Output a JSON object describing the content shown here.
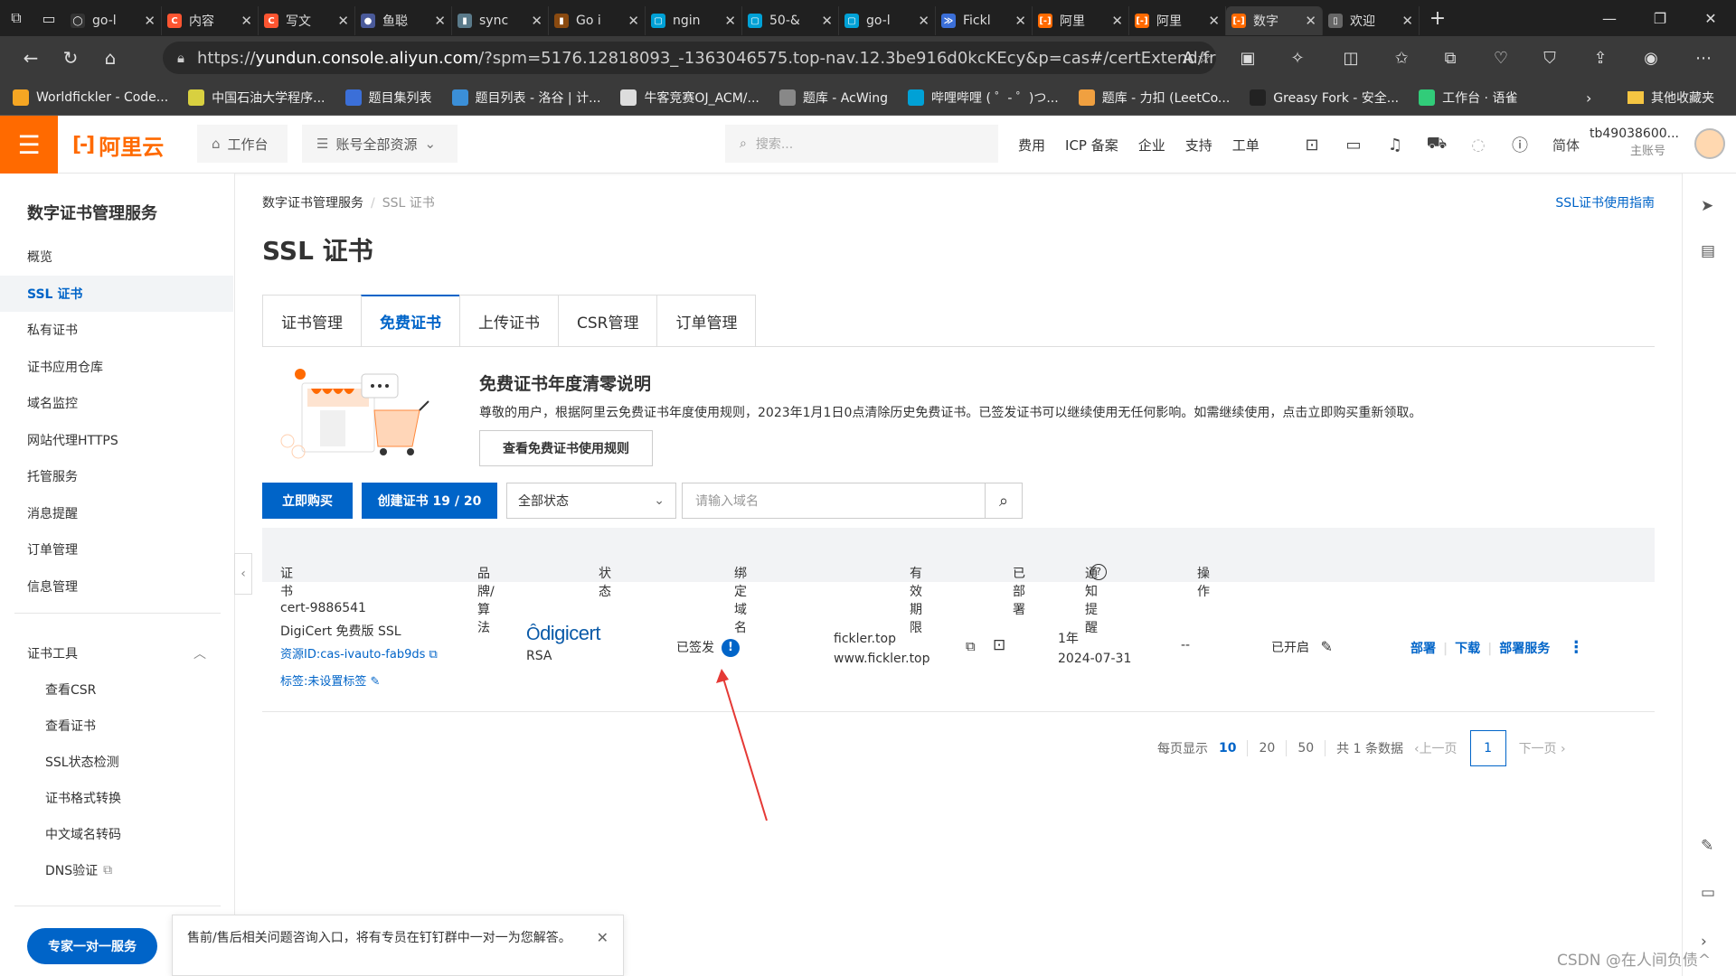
{
  "browser": {
    "tabs": [
      {
        "label": "go-l",
        "fav": "#333",
        "ftxt": "◯"
      },
      {
        "label": "内容",
        "fav": "#fc5531",
        "ftxt": "C"
      },
      {
        "label": "写文",
        "fav": "#fc5531",
        "ftxt": "C"
      },
      {
        "label": "鱼聪",
        "fav": "#4a5a9a",
        "ftxt": "●"
      },
      {
        "label": "sync",
        "fav": "#5a7a8a",
        "ftxt": "▮"
      },
      {
        "label": "Go i",
        "fav": "#8a4a10",
        "ftxt": "▮"
      },
      {
        "label": "ngin",
        "fav": "#00a1d6",
        "ftxt": "▢"
      },
      {
        "label": "50-&",
        "fav": "#00a1d6",
        "ftxt": "▢"
      },
      {
        "label": "go-l",
        "fav": "#00a1d6",
        "ftxt": "▢"
      },
      {
        "label": "Fickl",
        "fav": "#3b6fd8",
        "ftxt": "≫"
      },
      {
        "label": "阿里",
        "fav": "#ff6a00",
        "ftxt": "[-]"
      },
      {
        "label": "阿里",
        "fav": "#ff6a00",
        "ftxt": "[-]"
      },
      {
        "label": "数字",
        "fav": "#ff6a00",
        "ftxt": "[-]",
        "active": true
      },
      {
        "label": "欢迎",
        "fav": "#666",
        "ftxt": "▯"
      }
    ],
    "url_host": "yundun.console.aliyun.com",
    "url_prefix": "https://",
    "url_rest": "/?spm=5176.12818093_-1363046575.top-nav.12.3be916d0kcKEcy&p=cas#/certExtend/free/c...",
    "bookmarks": [
      {
        "label": "Worldfickler - Code...",
        "color": "#f5a623"
      },
      {
        "label": "中国石油大学程序...",
        "color": "#d8d040"
      },
      {
        "label": "题目集列表",
        "color": "#3b6fd8"
      },
      {
        "label": "题目列表 - 洛谷 | 计...",
        "color": "#3b8fd8"
      },
      {
        "label": "牛客竞赛OJ_ACM/...",
        "color": "#ddd"
      },
      {
        "label": "题库 - AcWing",
        "color": "#888"
      },
      {
        "label": "哔哩哔哩 ( ゜- ゜)つ...",
        "color": "#00a1d6"
      },
      {
        "label": "题库 - 力扣 (LeetCo...",
        "color": "#f0a040"
      },
      {
        "label": "Greasy Fork - 安全...",
        "color": "#222"
      },
      {
        "label": "工作台 · 语雀",
        "color": "#31cc79"
      }
    ],
    "bookmarks_other": "其他收藏夹"
  },
  "nav": {
    "logo": "阿里云",
    "workbench": "工作台",
    "resources": "账号全部资源",
    "search_placeholder": "搜索...",
    "links": [
      "费用",
      "ICP 备案",
      "企业",
      "支持",
      "工单"
    ],
    "lang": "简体",
    "account": "tb49038600...",
    "account_sub": "主账号"
  },
  "sidebar": {
    "title": "数字证书管理服务",
    "items": [
      "概览",
      "SSL 证书",
      "私有证书",
      "证书应用仓库",
      "域名监控",
      "网站代理HTTPS",
      "托管服务",
      "消息提醒",
      "订单管理",
      "信息管理"
    ],
    "tools_title": "证书工具",
    "tools": [
      "查看CSR",
      "查看证书",
      "SSL状态检测",
      "证书格式转换",
      "中文域名转码",
      "DNS验证"
    ],
    "expert_btn": "专家一对一服务",
    "tip": "售前/售后相关问题咨询入口，将有专员在钉钉群中一对一为您解答。"
  },
  "main": {
    "breadcrumb": [
      "数字证书管理服务",
      "SSL 证书"
    ],
    "guide": "SSL证书使用指南",
    "title": "SSL 证书",
    "tabs": [
      "证书管理",
      "免费证书",
      "上传证书",
      "CSR管理",
      "订单管理"
    ],
    "notice_title": "免费证书年度清零说明",
    "notice_text": "尊敬的用户，根据阿里云免费证书年度使用规则，2023年1月1日0点清除历史免费证书。已签发证书可以继续使用无任何影响。如需继续使用，点击立即购买重新领取。",
    "notice_btn": "查看免费证书使用规则",
    "buy_btn": "立即购买",
    "create_btn": "创建证书 19 / 20",
    "status_select": "全部状态",
    "domain_placeholder": "请输入域名",
    "columns": [
      "证书",
      "品牌/算法",
      "状态",
      "绑定域名",
      "有效期限",
      "已部署",
      "通知提醒",
      "操作"
    ],
    "row": {
      "id": "cert-9886541",
      "name": "DigiCert 免费版 SSL",
      "resource": "资源ID:cas-ivauto-fab9ds",
      "tag": "标签:未设置标签",
      "brand": "digicert",
      "algo": "RSA",
      "status": "已签发",
      "domain1": "fickler.top",
      "domain2": "www.fickler.top",
      "period": "1年",
      "expire": "2024-07-31",
      "deployed": "--",
      "notify": "已开启",
      "actions": [
        "部署",
        "下载",
        "部署服务"
      ]
    },
    "pager": {
      "per_page_label": "每页显示",
      "sizes": [
        "10",
        "20",
        "50"
      ],
      "total": "共 1 条数据",
      "prev": "上一页",
      "page": "1",
      "next": "下一页"
    }
  },
  "watermark": "CSDN @在人间负债^"
}
